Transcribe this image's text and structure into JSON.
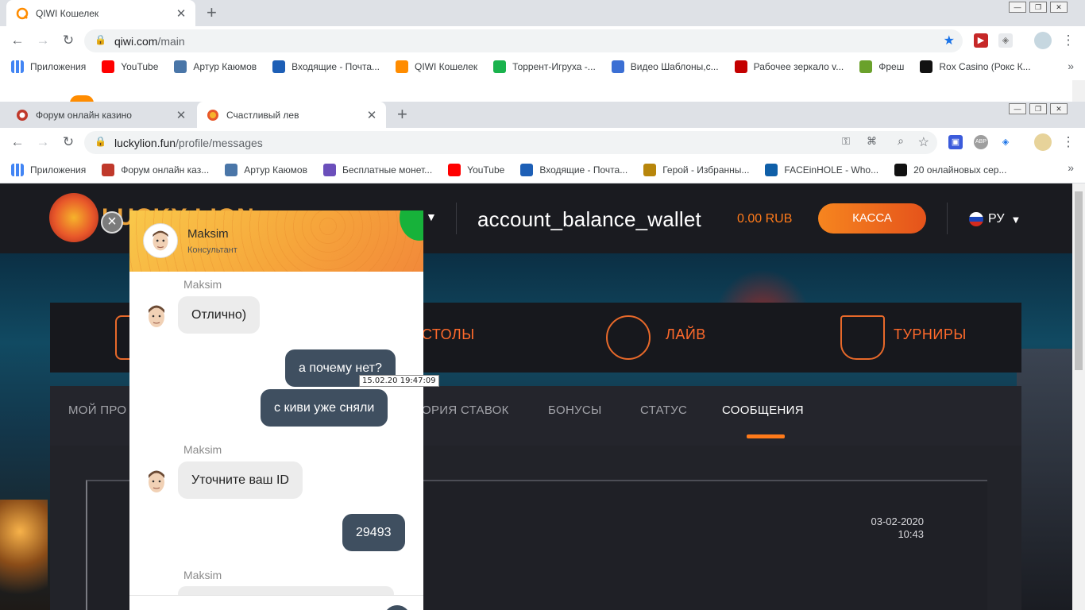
{
  "window1": {
    "tab_title": "QIWI Кошелек",
    "url_host": "qiwi.com",
    "url_path": "/main",
    "bookmarks": [
      {
        "label": "Приложения",
        "icon": "apps-icon",
        "color": "#4285f4"
      },
      {
        "label": "YouTube",
        "icon": "youtube-icon",
        "color": "#ff0000"
      },
      {
        "label": "Артур Каюмов",
        "icon": "vk-chat-icon",
        "color": "#4a76a8"
      },
      {
        "label": "Входящие - Почта...",
        "icon": "mail-icon",
        "color": "#1d5fb6"
      },
      {
        "label": "QIWI Кошелек",
        "icon": "qiwi-icon",
        "color": "#ff8c00"
      },
      {
        "label": "Торрент-Игруха -...",
        "icon": "torrent-icon",
        "color": "#1ab34d"
      },
      {
        "label": "Видео Шаблоны,с...",
        "icon": "play-icon",
        "color": "#3b6fd4"
      },
      {
        "label": "Рабочее зеркало v...",
        "icon": "v-icon",
        "color": "#c40000"
      },
      {
        "label": "Фреш",
        "icon": "fresh-icon",
        "color": "#6aa12b"
      },
      {
        "label": "Rox Casino (Рокс К...",
        "icon": "rox-icon",
        "color": "#111111"
      }
    ]
  },
  "window2": {
    "tabs": [
      {
        "label": "Форум онлайн казино",
        "icon": "casino-chip-icon"
      },
      {
        "label": "Счастливый лев",
        "icon": "lion-icon"
      }
    ],
    "url_host": "luckylion.fun",
    "url_path": "/profile/messages",
    "bookmarks": [
      {
        "label": "Приложения",
        "icon": "apps-icon",
        "color": "#4285f4"
      },
      {
        "label": "Форум онлайн каз...",
        "icon": "casino-chip-icon",
        "color": "#c0392b"
      },
      {
        "label": "Артур Каюмов",
        "icon": "vk-icon",
        "color": "#4a76a8"
      },
      {
        "label": "Бесплатные монет...",
        "icon": "coins-icon",
        "color": "#6b4fbb"
      },
      {
        "label": "YouTube",
        "icon": "youtube-icon",
        "color": "#ff0000"
      },
      {
        "label": "Входящие - Почта...",
        "icon": "mail-icon",
        "color": "#1d5fb6"
      },
      {
        "label": "Герой - Избранны...",
        "icon": "star-icon",
        "color": "#b8860b"
      },
      {
        "label": "FACEinHOLE - Who...",
        "icon": "face-icon",
        "color": "#0f5fa8"
      },
      {
        "label": "20 онлайновых сер...",
        "icon": "itc-icon",
        "color": "#111111"
      }
    ]
  },
  "site": {
    "logo_text": "LUCKY LION",
    "balance_label": "account_balance_wallet",
    "balance_value": "0.00",
    "currency": "RUB",
    "kassa_label": "КАССА",
    "lang": "РУ",
    "categories": [
      "СТОЛЫ",
      "ЛАЙВ",
      "ТУРНИРЫ"
    ],
    "profile_tabs": [
      "МОЙ ПРО",
      "ОРИЯ СТАВОК",
      "БОНУСЫ",
      "СТАТУС",
      "СООБЩЕНИЯ"
    ],
    "active_tab": "СООБЩЕНИЯ",
    "message_date": "03-02-2020",
    "message_time": "10:43",
    "accent": "#ff7a1a"
  },
  "chat": {
    "agent_name": "Maksim",
    "agent_role": "Консультант",
    "messages": [
      {
        "from": "agent",
        "sender": "Maksim",
        "text": "Отлично)"
      },
      {
        "from": "user",
        "text": "а почему нет?"
      },
      {
        "from": "user",
        "text": "с киви уже сняли"
      },
      {
        "from": "agent",
        "sender": "Maksim",
        "text": "Уточните ваш ID"
      },
      {
        "from": "user",
        "text": "29493"
      },
      {
        "from": "agent",
        "sender": "Maksim",
        "text": ""
      }
    ],
    "tooltip": "15.02.20 19:47:09",
    "user_bubble_color": "#3f4f60",
    "agent_bubble_color": "#ececec"
  }
}
